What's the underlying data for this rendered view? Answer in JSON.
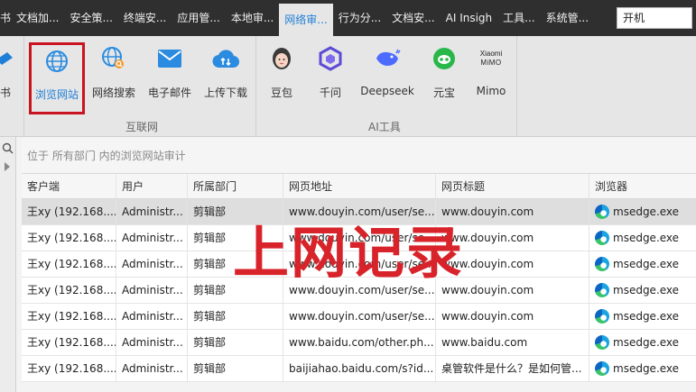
{
  "menubar": {
    "items": [
      "书",
      "文档加...",
      "安全策...",
      "终端安...",
      "应用管...",
      "本地审...",
      "网络审...",
      "行为分...",
      "文档安...",
      "AI Insigh",
      "工具...",
      "系统管..."
    ],
    "active_index": 6,
    "search_value": "开机"
  },
  "ribbon": {
    "left_partial_label": "书",
    "internet_group": {
      "label": "互联网",
      "buttons": [
        {
          "label": "浏览网站",
          "icon": "globe-icon",
          "selected": true
        },
        {
          "label": "网络搜索",
          "icon": "globe-search-icon"
        },
        {
          "label": "电子邮件",
          "icon": "mail-icon"
        },
        {
          "label": "上传下载",
          "icon": "cloud-transfer-icon"
        }
      ]
    },
    "ai_group": {
      "label": "AI工具",
      "buttons": [
        {
          "label": "豆包",
          "icon": "doubao-icon"
        },
        {
          "label": "千问",
          "icon": "qianwen-icon"
        },
        {
          "label": "Deepseek",
          "icon": "deepseek-icon"
        },
        {
          "label": "元宝",
          "icon": "yuanbao-icon"
        },
        {
          "label": "Mimo",
          "icon": "xiaomi-mimo-icon",
          "logo_text": "Xiaomi MiMO"
        }
      ]
    }
  },
  "breadcrumb": "位于 所有部门 内的浏览网站审计",
  "table": {
    "headers": [
      "客户端",
      "用户",
      "所属部门",
      "网页地址",
      "网页标题",
      "浏览器"
    ],
    "rows": [
      [
        "王xy (192.168....",
        "Administr...",
        "剪辑部",
        "www.douyin.com/user/se...",
        "www.douyin.com",
        "msedge.exe"
      ],
      [
        "王xy (192.168....",
        "Administr...",
        "剪辑部",
        "www.douyin.com/user/se...",
        "www.douyin.com",
        "msedge.exe"
      ],
      [
        "王xy (192.168....",
        "Administr...",
        "剪辑部",
        "www.douyin.com/user/se...",
        "www.douyin.com",
        "msedge.exe"
      ],
      [
        "王xy (192.168....",
        "Administr...",
        "剪辑部",
        "www.douyin.com/user/se...",
        "www.douyin.com",
        "msedge.exe"
      ],
      [
        "王xy (192.168....",
        "Administr...",
        "剪辑部",
        "www.douyin.com/user/se...",
        "www.douyin.com",
        "msedge.exe"
      ],
      [
        "王xy (192.168....",
        "Administr...",
        "剪辑部",
        "www.baidu.com/other.ph...",
        "www.baidu.com",
        "msedge.exe"
      ],
      [
        "王xy (192.168....",
        "Administr...",
        "剪辑部",
        "baijiahao.baidu.com/s?id...",
        "桌管软件是什么？是如何管...",
        "msedge.exe"
      ]
    ],
    "selected_row": 0
  },
  "overlay_text": "上网记录",
  "colors": {
    "accent": "#1f7fd6",
    "highlight": "#c8141e",
    "overlay": "#d8232a"
  }
}
